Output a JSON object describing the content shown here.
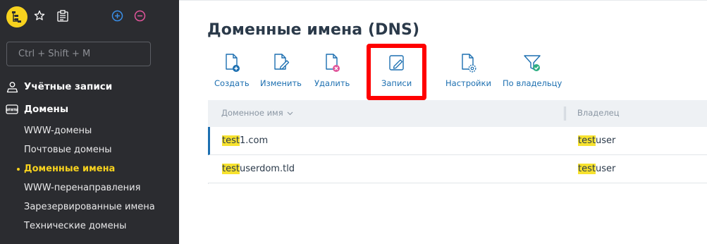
{
  "sidebar": {
    "search_placeholder": "Ctrl + Shift + M",
    "sections": [
      {
        "label": "Учётные записи",
        "icon": "user-pin-icon"
      },
      {
        "label": "Домены",
        "icon": "domain-www-icon"
      }
    ],
    "domain_items": [
      {
        "label": "WWW-домены"
      },
      {
        "label": "Почтовые домены"
      },
      {
        "label": "Доменные имена",
        "active": true
      },
      {
        "label": "WWW-перенаправления"
      },
      {
        "label": "Зарезервированные имена"
      },
      {
        "label": "Технические домены"
      }
    ]
  },
  "main": {
    "title": "Доменные имена (DNS)",
    "toolbar": [
      {
        "label": "Создать",
        "icon": "document-add-icon"
      },
      {
        "label": "Изменить",
        "icon": "document-edit-icon"
      },
      {
        "label": "Удалить",
        "icon": "document-delete-icon"
      },
      {
        "label": "Записи",
        "icon": "pencil-edit-icon"
      },
      {
        "label": "Настройки",
        "icon": "document-settings-icon"
      },
      {
        "label": "По владельцу",
        "icon": "filter-check-icon"
      }
    ],
    "table": {
      "columns": [
        "Доменное имя",
        "Владелец"
      ],
      "rows": [
        {
          "domain_highlight": "test",
          "domain_rest": "1.com",
          "owner_highlight": "test",
          "owner_rest": "user"
        },
        {
          "domain_highlight": "test",
          "domain_rest": "userdom.tld",
          "owner_highlight": "test",
          "owner_rest": "user"
        }
      ]
    }
  },
  "colors": {
    "sidebar_bg": "#2b2c30",
    "accent_yellow": "#f7d21e",
    "link_blue": "#1c6fb0",
    "highlight_red": "#ff0000"
  }
}
